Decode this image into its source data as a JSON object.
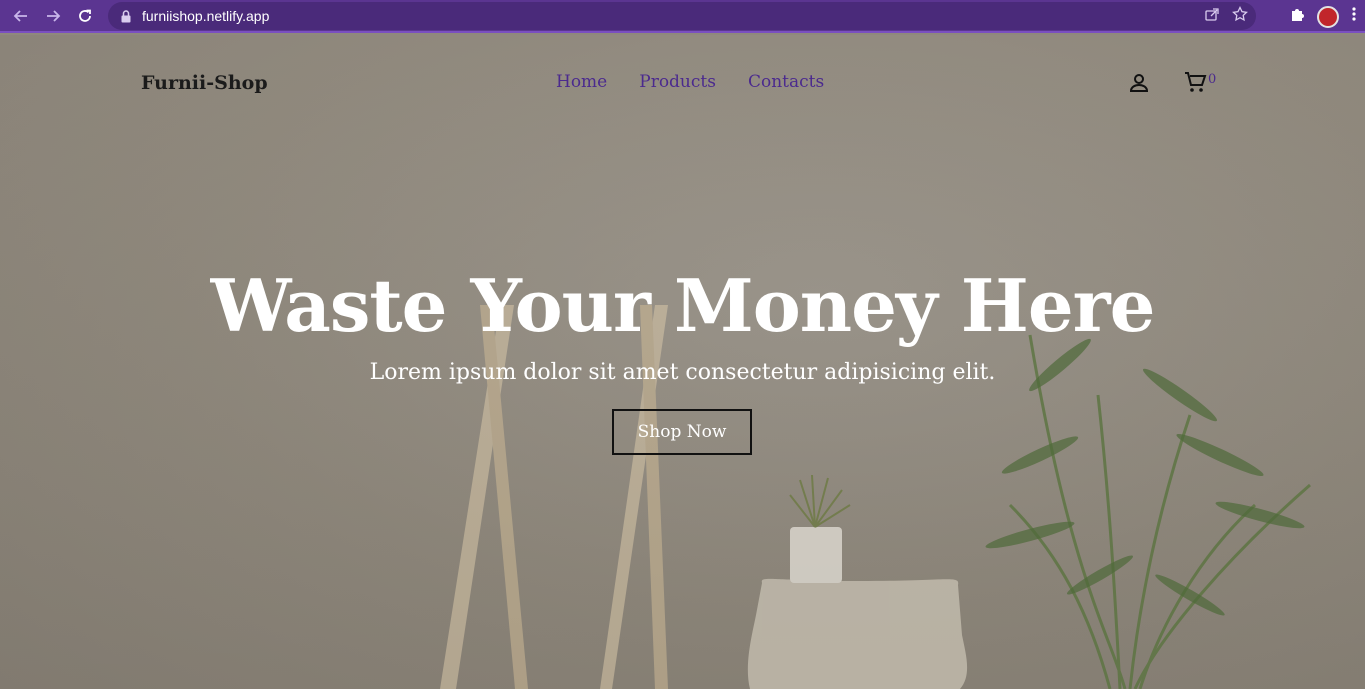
{
  "browser": {
    "url": "furniishop.netlify.app",
    "icons": [
      "back-arrow-icon",
      "forward-arrow-icon",
      "reload-icon",
      "lock-icon",
      "share-icon",
      "star-icon",
      "puzzle-icon",
      "profile-avatar",
      "more-vert-icon"
    ],
    "colors": {
      "chrome": "#5b3591",
      "omnibox": "#4a2a7a"
    }
  },
  "header": {
    "brand": "Furnii-Shop",
    "nav": [
      {
        "label": "Home"
      },
      {
        "label": "Products"
      },
      {
        "label": "Contacts"
      }
    ],
    "cart_count": "0",
    "icons": [
      "person-icon",
      "cart-icon"
    ]
  },
  "hero": {
    "title": "Waste Your Money Here",
    "subtitle": "Lorem ipsum dolor sit amet consectetur adipisicing elit.",
    "cta_label": "Shop Now"
  },
  "colors": {
    "accent": "#4b2a8e",
    "text_light": "#ffffff",
    "text_dark": "#1b1b1b"
  }
}
